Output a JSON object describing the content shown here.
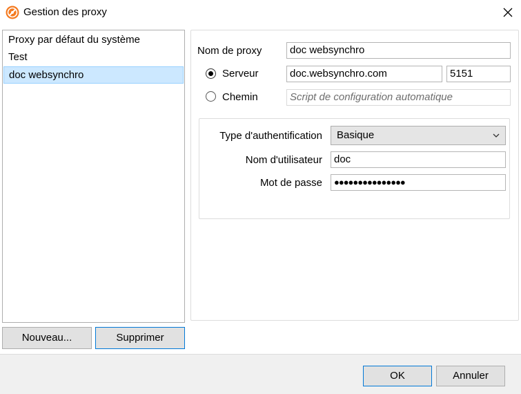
{
  "window": {
    "title": "Gestion des proxy"
  },
  "proxy_list": {
    "items": [
      {
        "label": "Proxy par défaut du système",
        "selected": false
      },
      {
        "label": "Test",
        "selected": false
      },
      {
        "label": "doc websynchro",
        "selected": true
      }
    ]
  },
  "list_buttons": {
    "new_label": "Nouveau...",
    "delete_label": "Supprimer"
  },
  "form": {
    "proxy_name_label": "Nom de proxy",
    "proxy_name_value": "doc websynchro",
    "server_label": "Serveur",
    "server_selected": true,
    "server_value": "doc.websynchro.com",
    "port_value": "5151",
    "path_label": "Chemin",
    "path_selected": false,
    "path_placeholder": "Script de configuration automatique"
  },
  "auth": {
    "type_label": "Type d'authentification",
    "type_value": "Basique",
    "username_label": "Nom d'utilisateur",
    "username_value": "doc",
    "password_label": "Mot de passe",
    "password_mask": "●●●●●●●●●●●●●●●"
  },
  "footer": {
    "ok_label": "OK",
    "cancel_label": "Annuler"
  },
  "icons": {
    "app": "proxy-globe-icon",
    "close": "close-icon",
    "dropdown": "chevron-down-icon"
  },
  "colors": {
    "accent": "#0078d7",
    "selection_bg": "#cce8ff",
    "app_icon": "#f47a20"
  }
}
